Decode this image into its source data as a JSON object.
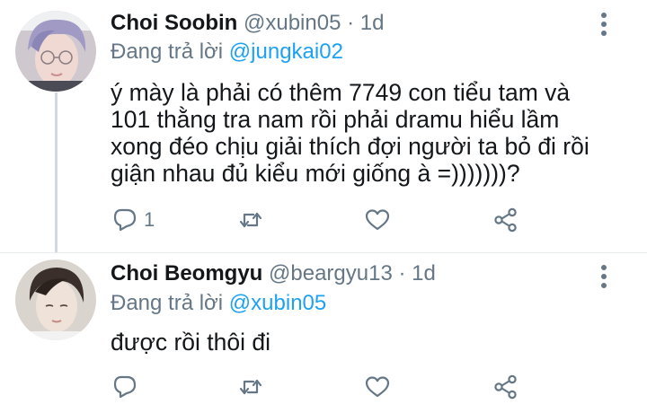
{
  "tweets": [
    {
      "name": "Choi Soobin",
      "handle": "@xubin05",
      "dot": "·",
      "time": "1d",
      "replying_prefix": "Đang trả lời ",
      "replying_to": "@jungkai02",
      "lines": [
        "ý mày là phải có thêm 7749 con tiểu tam và",
        "101 thằng tra nam rồi phải dramu hiểu lầm",
        "xong đéo chịu giải thích đợi người ta bỏ đi rồi",
        "giận nhau đủ kiểu mới giống à =)))))))?"
      ],
      "reply_count": "1",
      "icons": {
        "reply": "reply-icon",
        "retweet": "retweet-icon",
        "like": "heart-icon",
        "share": "share-icon",
        "more": "more-vertical-icon"
      }
    },
    {
      "name": "Choi Beomgyu",
      "handle": "@beargyu13",
      "dot": "·",
      "time": "1d",
      "replying_prefix": "Đang trả lời ",
      "replying_to": "@xubin05",
      "lines": [
        "được rồi thôi đi"
      ],
      "icons": {
        "reply": "reply-icon",
        "retweet": "retweet-icon",
        "like": "heart-icon",
        "share": "share-icon",
        "more": "more-vertical-icon"
      }
    }
  ],
  "colors": {
    "text": "#14171a",
    "secondary": "#657786",
    "link": "#1da1f2",
    "divider": "#e6ecf0",
    "thread_line": "#cfd9de"
  }
}
